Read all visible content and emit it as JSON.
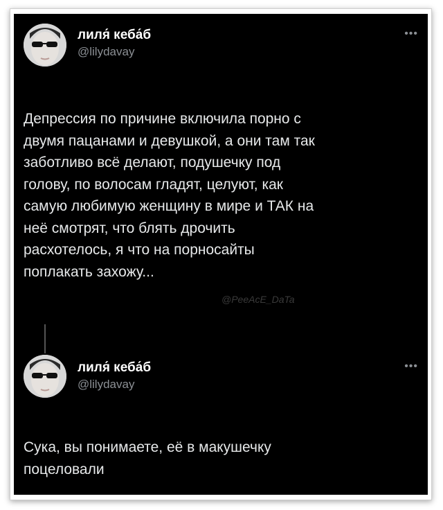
{
  "tweet1": {
    "name": "лиля́ кеба́б",
    "handle": "@lilydavay",
    "text": "Депрессия по причине включила порно с\nдвумя пацанами и девушкой, а они там так\nзаботливо всё делают, подушечку под\nголову, по волосам гладят, целуют, как\nсамую любимую женщину в мире и ТАК на\nнеё смотрят, что блять дрочить\nрасхотелось, я что на порносайты\nпоплакать захожу...",
    "watermark": "@PeeAcE_DaTa",
    "more_icon": "ellipsis-icon"
  },
  "tweet2": {
    "name": "лиля́ кеба́б",
    "handle": "@lilydavay",
    "text": "Сука, вы понимаете, её в макушечку\nпоцеловали",
    "more_icon": "ellipsis-icon"
  }
}
